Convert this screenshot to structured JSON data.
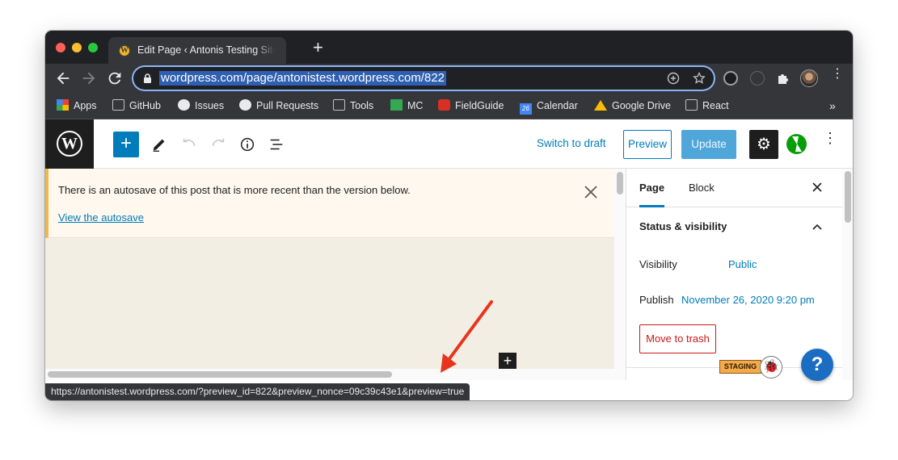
{
  "browser": {
    "tab_title": "Edit Page ‹ Antonis Testing Site — WordPress.com",
    "url": "wordpress.com/page/antonistest.wordpress.com/822",
    "bookmarks": [
      "Apps",
      "GitHub",
      "Issues",
      "Pull Requests",
      "Tools",
      "MC",
      "FieldGuide",
      "Calendar",
      "Google Drive",
      "React"
    ],
    "more_bookmarks": "»",
    "status_url": "https://antonistest.wordpress.com/?preview_id=822&preview_nonce=09c39c43e1&preview=true",
    "calendar_day": "26"
  },
  "editor": {
    "switch_to_draft": "Switch to draft",
    "preview": "Preview",
    "update": "Update"
  },
  "notice": {
    "text": "There is an autosave of this post that is more recent than the version below.",
    "link": "View the autosave"
  },
  "sidebar": {
    "tab_page": "Page",
    "tab_block": "Block",
    "section_title": "Status & visibility",
    "visibility_label": "Visibility",
    "visibility_value": "Public",
    "publish_label": "Publish",
    "publish_value": "November 26, 2020 9:20 pm",
    "move_to_trash": "Move to trash"
  },
  "badges": {
    "staging": "STAGING",
    "help": "?"
  },
  "colors": {
    "accent": "#007cba",
    "trash": "#cc1818",
    "notice_border": "#f0b849",
    "annotation_arrow": "#e8341c"
  }
}
